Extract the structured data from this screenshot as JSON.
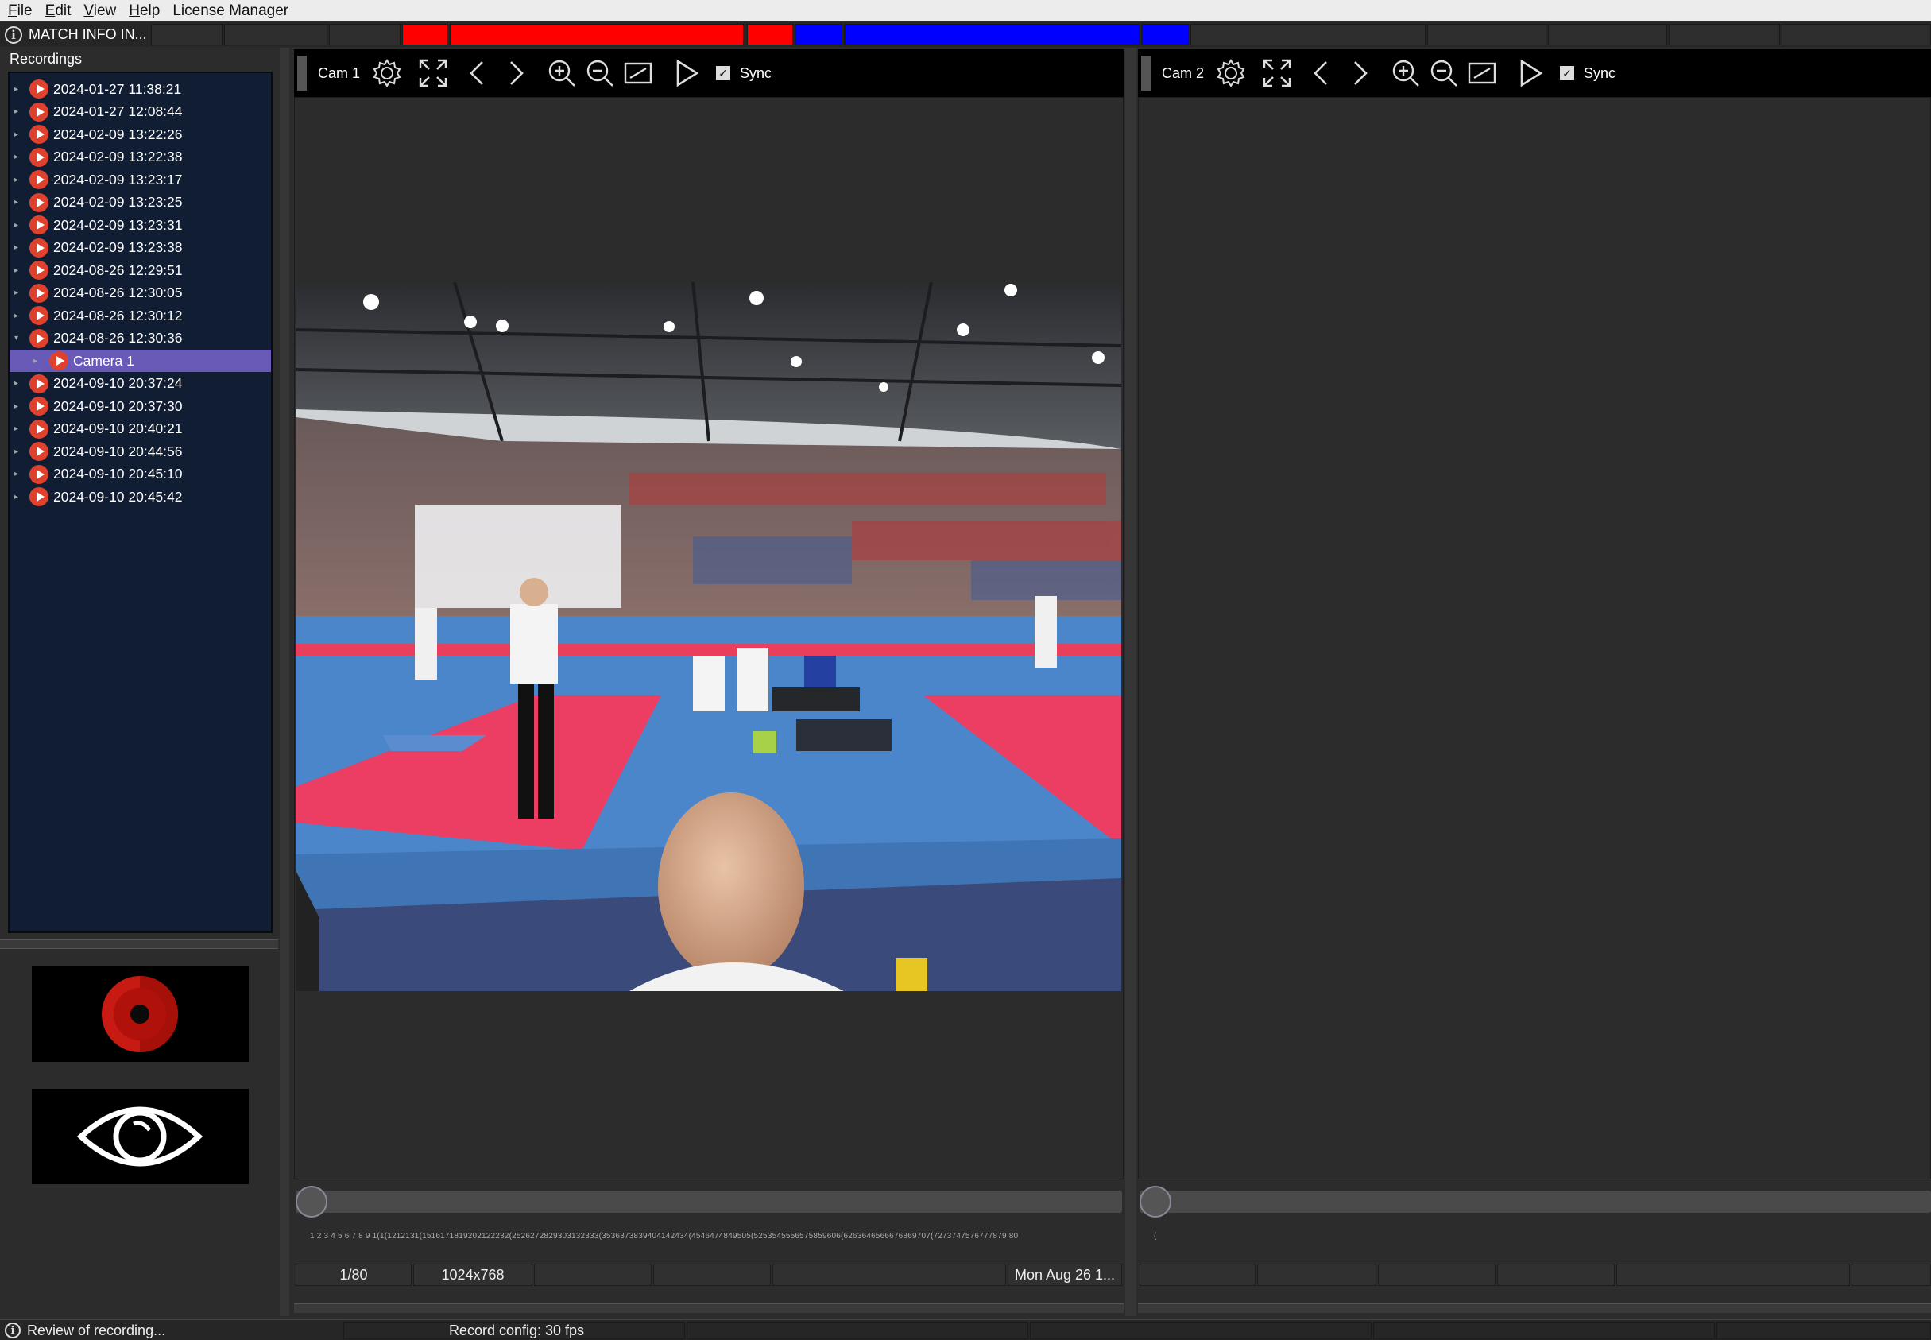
{
  "menu": {
    "file": "File",
    "edit": "Edit",
    "view": "View",
    "help": "Help",
    "license": "License Manager"
  },
  "matchbar": {
    "info_label": "MATCH INFO IN...",
    "segments": [
      {
        "color": "#2e2e2e"
      },
      {
        "color": "#2e2e2e"
      },
      {
        "color": "#2e2e2e"
      },
      {
        "color": "#ff0000"
      },
      {
        "color": "#ff0000"
      },
      {
        "color": "#ff0000"
      },
      {
        "color": "#0000ff"
      },
      {
        "color": "#0000ff"
      },
      {
        "color": "#0000ff"
      },
      {
        "color": "#2e2e2e"
      },
      {
        "color": "#2e2e2e"
      },
      {
        "color": "#2e2e2e"
      },
      {
        "color": "#2e2e2e"
      },
      {
        "color": "#2e2e2e"
      }
    ]
  },
  "recordings": {
    "title": "Recordings",
    "items": [
      "2024-01-27 11:38:21",
      "2024-01-27 12:08:44",
      "2024-02-09 13:22:26",
      "2024-02-09 13:22:38",
      "2024-02-09 13:23:17",
      "2024-02-09 13:23:25",
      "2024-02-09 13:23:31",
      "2024-02-09 13:23:38",
      "2024-08-26 12:29:51",
      "2024-08-26 12:30:05",
      "2024-08-26 12:30:12",
      "2024-08-26 12:30:36"
    ],
    "child": "Camera 1",
    "items_after": [
      "2024-09-10 20:37:24",
      "2024-09-10 20:37:30",
      "2024-09-10 20:40:21",
      "2024-09-10 20:44:56",
      "2024-09-10 20:45:10",
      "2024-09-10 20:45:42"
    ]
  },
  "cam1": {
    "label": "Cam 1",
    "sync": "Sync",
    "sync_checked": true,
    "frame": "1/80",
    "resolution": "1024x768",
    "date": "Mon Aug 26 1...",
    "timeline_position": 0.0
  },
  "cam2": {
    "label": "Cam 2",
    "sync": "Sync",
    "sync_checked": true,
    "timeline_position": 0.0
  },
  "ticks": "1 2 3 4 5 6 7 8 9 1(1(1212131(1516171819202122232(2526272829303132333(3536373839404142434(4546474849505(5253545556575859606(6263646566676869707(7273747576777879 80",
  "tick_short": "(",
  "status": {
    "left": "Review of recording...",
    "record_config": "Record config: 30 fps"
  },
  "colors": {
    "accent_red": "#e0412c",
    "tree_bg": "#101d33",
    "selected": "#6a5ab8"
  }
}
